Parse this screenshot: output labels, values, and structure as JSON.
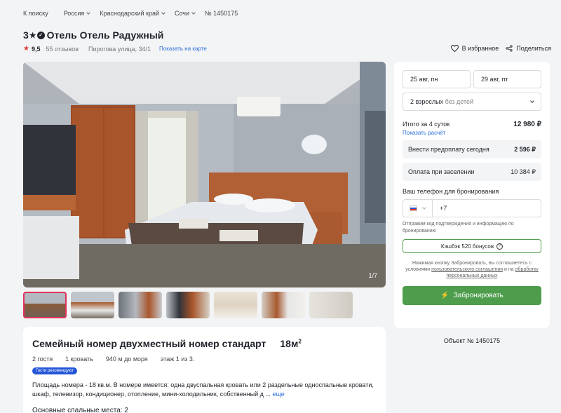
{
  "breadcrumbs": {
    "back": "К поиску",
    "country": "Россия",
    "region": "Краснодарский край",
    "city": "Сочи",
    "id": "№ 1450175"
  },
  "hotel": {
    "stars": "3",
    "name": "Отель Отель Радужный",
    "rating": "9,5",
    "reviews": "55 отзывов",
    "address": "Пирогова улица, 34/1",
    "map_link": "Показать на карте"
  },
  "actions": {
    "favorite": "В избранное",
    "share": "Поделиться"
  },
  "gallery": {
    "counter": "1/7",
    "thumb_count": 7
  },
  "room": {
    "title": "Семейный номер двухместный номер стандарт",
    "area": "18м",
    "area_sup": "2",
    "guests": "2 гостя",
    "beds": "1 кровать",
    "distance": "940 м до моря",
    "floor": "этаж 1 из 3.",
    "badge": "Гости рекомендуют",
    "description": "Площадь номера - 18 кв.м. В номере имеется: одна двуспальная кровать или 2 раздельные односпальные кровати, шкаф, телевизор, кондиционер, отопление, мини-холодильник, собственный д ...",
    "more": "еще",
    "main_beds": "Основные спальные места: 2"
  },
  "booking": {
    "check_in": "25 авг, пн",
    "check_out": "29 авг, пт",
    "guests": "2 взрослых",
    "guests_sub": "без детей",
    "total_label": "Итого за 4 суток",
    "total_value": "12 980 ₽",
    "calc_link": "Показать расчёт",
    "prepay_label": "Внести предоплату сегодня",
    "prepay_value": "2 596 ₽",
    "onsite_label": "Оплата при заселении",
    "onsite_value": "10 384 ₽",
    "phone_label": "Ваш телефон для бронирования",
    "phone_prefix": "+7",
    "phone_hint": "Отправим код подтверждения и информацию по бронированию",
    "cashback": "Кэшбэк 520 бонусов",
    "terms_text": "Нажимая кнопку Забронировать, вы соглашаетесь с условиями",
    "terms_link1": "пользовательского соглашения",
    "terms_and": "и на",
    "terms_link2": "обработку персональных данных",
    "book_button": "Забронировать",
    "object_id": "Объект № 1450175"
  },
  "colors": {
    "accent_green": "#4e9d4c",
    "link_blue": "#2a6fdb",
    "rating_red": "#e2372d",
    "badge_blue": "#2456d6"
  }
}
